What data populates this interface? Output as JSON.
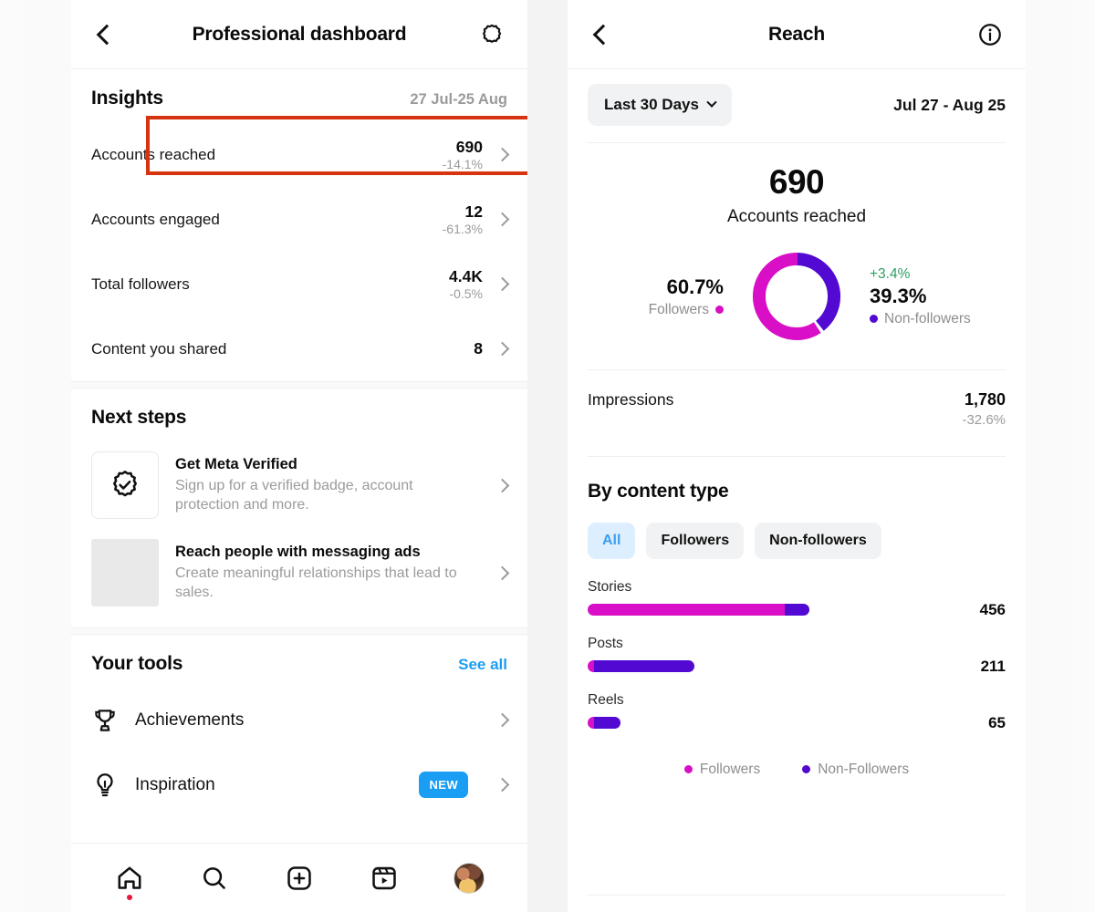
{
  "left_panel": {
    "header": {
      "back_icon": "chevron-left-icon",
      "title": "Professional dashboard",
      "settings_icon": "gear-icon"
    },
    "insights": {
      "title": "Insights",
      "date_range": "27 Jul-25 Aug",
      "rows": [
        {
          "label": "Accounts reached",
          "value": "690",
          "delta": "-14.1%",
          "highlighted": true
        },
        {
          "label": "Accounts engaged",
          "value": "12",
          "delta": "-61.3%",
          "highlighted": false
        },
        {
          "label": "Total followers",
          "value": "4.4K",
          "delta": "-0.5%",
          "highlighted": false
        },
        {
          "label": "Content you shared",
          "value": "8",
          "delta": "",
          "highlighted": false
        }
      ]
    },
    "next_steps": {
      "title": "Next steps",
      "items": [
        {
          "icon": "verified-badge-icon",
          "title": "Get Meta Verified",
          "subtitle": "Sign up for a verified badge, account protection and more."
        },
        {
          "icon": "image-placeholder-icon",
          "title": "Reach people with messaging ads",
          "subtitle": "Create meaningful relationships that lead to sales."
        }
      ]
    },
    "your_tools": {
      "title": "Your tools",
      "see_all": "See all",
      "items": [
        {
          "icon": "trophy-icon",
          "label": "Achievements",
          "badge": ""
        },
        {
          "icon": "lightbulb-icon",
          "label": "Inspiration",
          "badge": "NEW"
        }
      ]
    },
    "tabbar": [
      {
        "icon": "home-icon",
        "has_dot": true
      },
      {
        "icon": "search-icon",
        "has_dot": false
      },
      {
        "icon": "create-plus-icon",
        "has_dot": false
      },
      {
        "icon": "reels-icon",
        "has_dot": false
      },
      {
        "icon": "profile-avatar-icon",
        "has_dot": false
      }
    ]
  },
  "right_panel": {
    "header": {
      "back_icon": "chevron-left-icon",
      "title": "Reach",
      "info_icon": "info-circle-icon"
    },
    "range": {
      "chip_label": "Last 30 Days",
      "chip_caret": "chevron-down-icon",
      "dates": "Jul 27 - Aug 25"
    },
    "summary": {
      "value": "690",
      "label": "Accounts reached"
    },
    "donut": {
      "left_pct": "60.7%",
      "left_label": "Followers",
      "right_delta": "+3.4%",
      "right_pct": "39.3%",
      "right_label": "Non-followers"
    },
    "impressions": {
      "label": "Impressions",
      "value": "1,780",
      "delta": "-32.6%"
    },
    "by_content_type": {
      "title": "By content type",
      "chips": [
        {
          "label": "All",
          "active": true
        },
        {
          "label": "Followers",
          "active": false
        },
        {
          "label": "Non-followers",
          "active": false
        }
      ],
      "legend": [
        {
          "label": "Followers",
          "color": "#d80fc6"
        },
        {
          "label": "Non-Followers",
          "color": "#5209d2"
        }
      ]
    }
  },
  "colors": {
    "followers": "#d80fc6",
    "non_followers": "#5209d2",
    "accent_blue": "#1a9ef4",
    "positive_green": "#2e9e63",
    "annotation_red": "#d6330e"
  },
  "chart_data": [
    {
      "type": "pie",
      "title": "Accounts reached",
      "subtitle": "690",
      "labels": [
        "Followers",
        "Non-followers"
      ],
      "values": [
        60.7,
        39.3
      ],
      "value_unit": "%",
      "colors": [
        "#d80fc6",
        "#5209d2"
      ],
      "annotations": [
        "+3.4%"
      ],
      "legend": "sides",
      "donut": true
    },
    {
      "type": "bar",
      "title": "By content type",
      "orientation": "horizontal",
      "stacked": true,
      "categories": [
        "Stories",
        "Posts",
        "Reels"
      ],
      "totals": [
        456,
        211,
        65
      ],
      "series": [
        {
          "name": "Followers",
          "color": "#d80fc6",
          "values": [
            406,
            6,
            5
          ]
        },
        {
          "name": "Non-Followers",
          "color": "#5209d2",
          "values": [
            50,
            205,
            60
          ]
        }
      ],
      "xlabel": "",
      "ylabel": "",
      "grid": false,
      "legend_position": "bottom",
      "xlim": [
        0,
        456
      ]
    }
  ]
}
